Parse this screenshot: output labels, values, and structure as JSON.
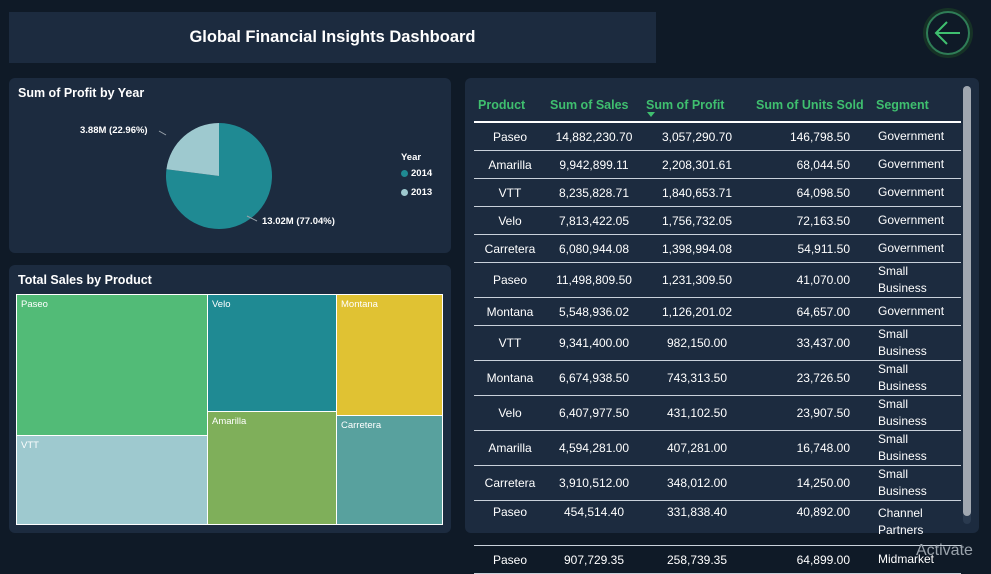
{
  "header": {
    "title": "Global Financial Insights Dashboard"
  },
  "pie": {
    "title": "Sum of Profit by Year",
    "legend_title": "Year",
    "colors": {
      "y2014": "#1f8a93",
      "y2013": "#9ec9cf"
    },
    "chart_data": {
      "type": "pie",
      "slices": [
        {
          "name": "2014",
          "value": 13.02,
          "percent": 77.04,
          "label": "13.02M (77.04%)"
        },
        {
          "name": "2013",
          "value": 3.88,
          "percent": 22.96,
          "label": "3.88M (22.96%)"
        }
      ]
    }
  },
  "treemap": {
    "title": "Total Sales by Product",
    "cells": [
      "Paseo",
      "VTT",
      "Velo",
      "Amarilla",
      "Montana",
      "Carretera"
    ]
  },
  "table": {
    "columns": [
      "Product",
      "Sum of Sales",
      "Sum of Profit",
      "Sum of Units Sold",
      "Segment"
    ],
    "rows": [
      [
        "Paseo",
        "14,882,230.70",
        "3,057,290.70",
        "146,798.50",
        "Government"
      ],
      [
        "Amarilla",
        "9,942,899.11",
        "2,208,301.61",
        "68,044.50",
        "Government"
      ],
      [
        "VTT",
        "8,235,828.71",
        "1,840,653.71",
        "64,098.50",
        "Government"
      ],
      [
        "Velo",
        "7,813,422.05",
        "1,756,732.05",
        "72,163.50",
        "Government"
      ],
      [
        "Carretera",
        "6,080,944.08",
        "1,398,994.08",
        "54,911.50",
        "Government"
      ],
      [
        "Paseo",
        "11,498,809.50",
        "1,231,309.50",
        "41,070.00",
        "Small Business"
      ],
      [
        "Montana",
        "5,548,936.02",
        "1,126,201.02",
        "64,657.00",
        "Government"
      ],
      [
        "VTT",
        "9,341,400.00",
        "982,150.00",
        "33,437.00",
        "Small Business"
      ],
      [
        "Montana",
        "6,674,938.50",
        "743,313.50",
        "23,726.50",
        "Small Business"
      ],
      [
        "Velo",
        "6,407,977.50",
        "431,102.50",
        "23,907.50",
        "Small Business"
      ],
      [
        "Amarilla",
        "4,594,281.00",
        "407,281.00",
        "16,748.00",
        "Small Business"
      ],
      [
        "Carretera",
        "3,910,512.00",
        "348,012.00",
        "14,250.00",
        "Small Business"
      ],
      [
        "Paseo",
        "454,514.40",
        "331,838.40",
        "40,892.00",
        "Channel Partners"
      ],
      [
        "Paseo",
        "907,729.35",
        "258,739.35",
        "64,899.00",
        "Midmarket"
      ]
    ]
  },
  "watermark": "Activate"
}
